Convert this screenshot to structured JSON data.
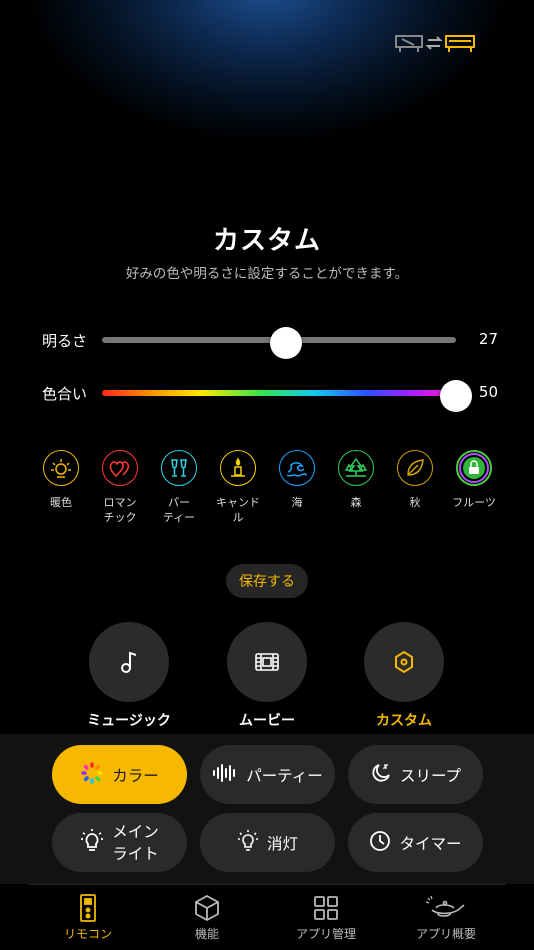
{
  "header": {
    "sync_icon": "room-swap-icon"
  },
  "title": "カスタム",
  "subtitle": "好みの色や明るさに設定することができます。",
  "sliders": {
    "brightness": {
      "label": "明るさ",
      "value": "27",
      "level": 0.52
    },
    "hue": {
      "label": "色合い",
      "value": "50",
      "level": 1.0
    }
  },
  "scenes": [
    {
      "label": "暖色",
      "icon": "sun-icon",
      "color": "#f3b800"
    },
    {
      "label": "ロマン\nチック",
      "icon": "hearts-icon",
      "color": "#ff3b30"
    },
    {
      "label": "パー\nティー",
      "icon": "glasses-icon",
      "color": "#2fd6e6"
    },
    {
      "label": "キャンド\nル",
      "icon": "candle-icon",
      "color": "#f3d000"
    },
    {
      "label": "海",
      "icon": "wave-icon",
      "color": "#1aa3ff"
    },
    {
      "label": "森",
      "icon": "forest-icon",
      "color": "#2fd05a"
    },
    {
      "label": "秋",
      "icon": "leaf-icon",
      "color": "#d4a000"
    },
    {
      "label": "フルーツ",
      "icon": "fruit-icon",
      "color": "#46d13a"
    }
  ],
  "save_label": "保存する",
  "modes": [
    {
      "label": "ミュージック",
      "icon": "music-note-icon"
    },
    {
      "label": "ムービー",
      "icon": "film-icon"
    },
    {
      "label": "カスタム",
      "icon": "hexagon-icon",
      "active": true
    }
  ],
  "panel": {
    "color": "カラー",
    "party": "パーティー",
    "sleep": "スリープ",
    "main_light": "メイン\nライト",
    "off": "消灯",
    "timer": "タイマー"
  },
  "tabs": [
    {
      "label": "リモコン",
      "icon": "remote-icon",
      "active": true
    },
    {
      "label": "機能",
      "icon": "cube-icon"
    },
    {
      "label": "アプリ管理",
      "icon": "grid-icon"
    },
    {
      "label": "アプリ概要",
      "icon": "genie-lamp-icon"
    }
  ],
  "colors": {
    "accent": "#f3b800",
    "background": "#000000",
    "button": "#2a2a2a"
  }
}
